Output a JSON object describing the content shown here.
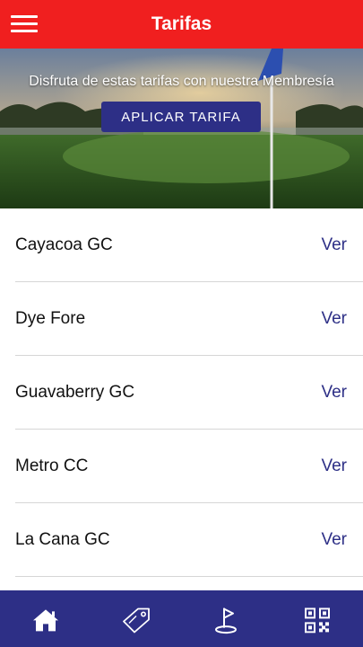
{
  "header": {
    "title": "Tarifas",
    "menu_icon": "hamburger-menu-icon"
  },
  "hero": {
    "text": "Disfruta de estas tarifas con nuestra Membresía",
    "button_label": "APLICAR TARIFA"
  },
  "list": {
    "items": [
      {
        "name": "Cayacoa GC",
        "action": "Ver"
      },
      {
        "name": "Dye Fore",
        "action": "Ver"
      },
      {
        "name": "Guavaberry GC",
        "action": "Ver"
      },
      {
        "name": "Metro CC",
        "action": "Ver"
      },
      {
        "name": "La Cana GC",
        "action": "Ver"
      }
    ]
  },
  "tabbar": {
    "tabs": [
      {
        "icon": "home-icon"
      },
      {
        "icon": "tag-icon"
      },
      {
        "icon": "golf-flag-icon"
      },
      {
        "icon": "qr-code-icon"
      }
    ]
  },
  "colors": {
    "header": "#f01f1f",
    "accent": "#2d2f86",
    "divider": "#d6d6d6"
  }
}
